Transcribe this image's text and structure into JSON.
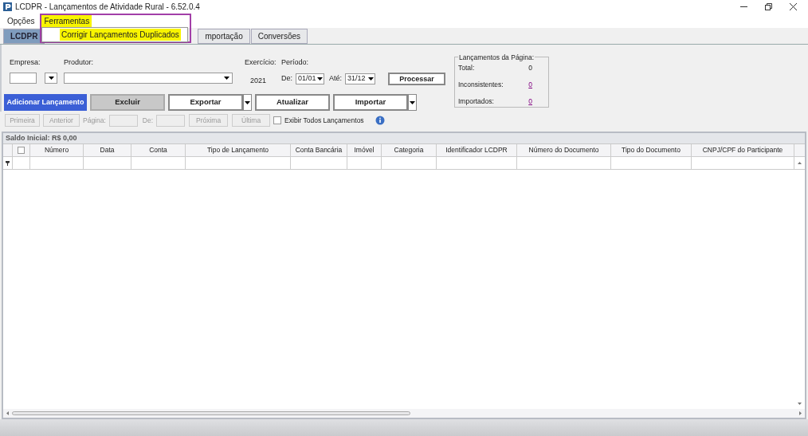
{
  "window": {
    "title": "LCDPR - Lançamentos de Atividade Rural - 6.52.0.4"
  },
  "menu_bar": [
    {
      "label": "Opções",
      "selected": false
    },
    {
      "label": "Ferramentas",
      "selected": true
    }
  ],
  "open_menu": {
    "items": [
      {
        "label": "Corrigir Lançamentos Duplicados",
        "highlighted": true
      }
    ]
  },
  "tabs": [
    {
      "label": "LCDPR",
      "selected": true
    },
    {
      "label": "mportação",
      "selected": false
    },
    {
      "label": "Conversões",
      "selected": false
    }
  ],
  "filters": {
    "empresa_label": "Empresa:",
    "produtor_label": "Produtor:",
    "exercicio_label": "Exercício:",
    "exercicio": "2021",
    "periodo_label": "Período:",
    "de_label": "De:",
    "de": "01/01",
    "ate_label": "Até:",
    "ate": "31/12",
    "process_button": "Processar"
  },
  "summary": {
    "title": "Lançamentos da Página:",
    "rows": [
      {
        "label": "Total:",
        "value": "0",
        "link": false
      },
      {
        "label": "Inconsistentes:",
        "value": "0",
        "link": true
      },
      {
        "label": "Importados:",
        "value": "0",
        "link": true
      }
    ]
  },
  "actions": [
    {
      "label": "Adicionar Lançamento",
      "kind": "primary",
      "dropdown": false
    },
    {
      "label": "Excluir",
      "kind": "disabled",
      "dropdown": false
    },
    {
      "label": "Exportar",
      "kind": "normal",
      "dropdown": true
    },
    {
      "label": "Atualizar",
      "kind": "normal",
      "dropdown": false
    },
    {
      "label": "Importar",
      "kind": "normal",
      "dropdown": true
    }
  ],
  "pager": {
    "first": "Primeira",
    "previous": "Anterior",
    "page_label": "Página:",
    "of_label": "De:",
    "next": "Próxima",
    "last": "Última",
    "show_all": {
      "label": "Exibir Todos Lançamentos",
      "checked": false
    }
  },
  "grid": {
    "caption": "Saldo Inicial: R$ 0,00",
    "select_all_checked": false,
    "columns": [
      "Número",
      "Data",
      "Conta",
      "Tipo de Lançamento",
      "Conta Bancária",
      "Imóvel",
      "Categoria",
      "Identificador LCDPR",
      "Número do Documento",
      "Tipo do Documento",
      "CNPJ/CPF do Participante"
    ]
  }
}
